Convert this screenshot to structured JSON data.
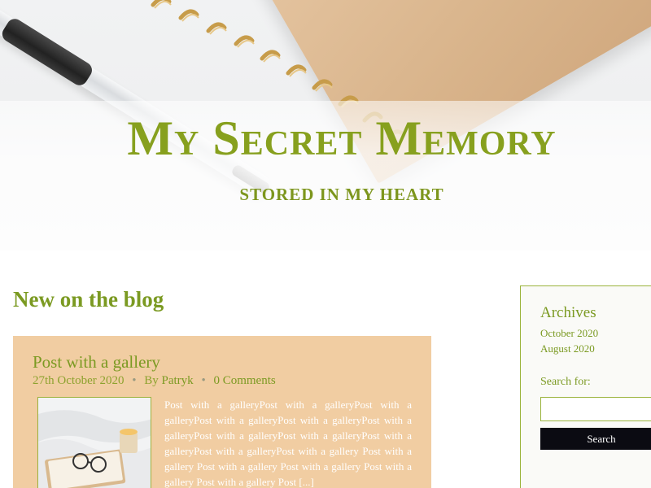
{
  "header": {
    "site_title": "My Secret Memory",
    "tagline": "STORED IN MY HEART"
  },
  "main": {
    "section_title": "New on the blog",
    "posts": [
      {
        "title": "Post with a gallery",
        "date": "27th October 2020",
        "by_label": "By",
        "author": "Patryk",
        "comments": "0 Comments",
        "excerpt": "Post with a galleryPost with a galleryPost with a galleryPost with a galleryPost with a galleryPost with a galleryPost with a galleryPost with a galleryPost with a galleryPost with a galleryPost with a gallery Post with a gallery Post with a gallery Post with a gallery Post with a gallery Post with a gallery Post [...]"
      }
    ]
  },
  "sidebar": {
    "archives_title": "Archives",
    "archives": [
      "October 2020",
      "August 2020"
    ],
    "search_label": "Search for:",
    "search_value": "",
    "search_button": "Search"
  },
  "colors": {
    "accent": "#7b9a22",
    "post_bg": "#f1cda2",
    "button_bg": "#0b0b12"
  }
}
